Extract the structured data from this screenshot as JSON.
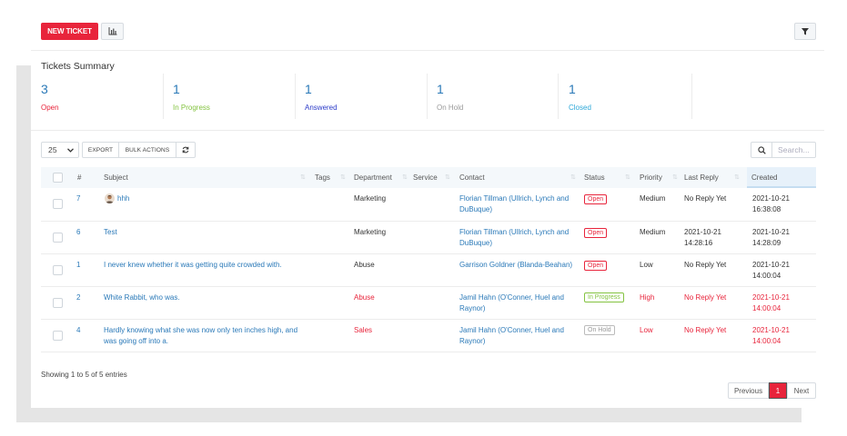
{
  "toolbar": {
    "new_ticket_label": "NEW TICKET",
    "stats_icon": "bar-chart-icon",
    "filter_icon": "filter-icon"
  },
  "summary": {
    "title": "Tickets Summary",
    "stats": [
      {
        "count": "3",
        "label": "Open",
        "color": "#e8243b"
      },
      {
        "count": "1",
        "label": "In Progress",
        "color": "#84c341"
      },
      {
        "count": "1",
        "label": "Answered",
        "color": "#2b3bc8"
      },
      {
        "count": "1",
        "label": "On Hold",
        "color": "#9a9a9a"
      },
      {
        "count": "1",
        "label": "Closed",
        "color": "#2ea8d8"
      }
    ]
  },
  "controls": {
    "page_length": "25",
    "export_label": "EXPORT",
    "bulk_actions_label": "BULK ACTIONS",
    "reload_icon": "refresh-icon",
    "search_icon": "search-icon",
    "search_placeholder": "Search..."
  },
  "table": {
    "headers": [
      "#",
      "Subject",
      "Tags",
      "Department",
      "Service",
      "Contact",
      "Status",
      "Priority",
      "Last Reply",
      "Created"
    ],
    "rows": [
      {
        "id": "7",
        "subject": "hhh",
        "subject_line2": "",
        "department": "Marketing",
        "contact": "Florian Tillman (Ullrich, Lynch and",
        "contact_line2": "DuBuque)",
        "status": "Open",
        "priority": "Medium",
        "last_reply": "No Reply Yet",
        "last_reply_line2": "",
        "created": "2021-10-21",
        "created_time": "16:38:08"
      },
      {
        "id": "6",
        "subject": "Test",
        "subject_line2": "",
        "department": "Marketing",
        "contact": "Florian Tillman (Ullrich, Lynch and",
        "contact_line2": "DuBuque)",
        "status": "Open",
        "priority": "Medium",
        "last_reply": "2021-10-21",
        "last_reply_line2": "14:28:16",
        "created": "2021-10-21",
        "created_time": "14:28:09"
      },
      {
        "id": "1",
        "subject": "I never knew whether it was getting quite crowded with.",
        "subject_line2": "",
        "department": "Abuse",
        "contact": "Garrison Goldner (Blanda-Beahan)",
        "contact_line2": "",
        "status": "Open",
        "priority": "Low",
        "last_reply": "No Reply Yet",
        "last_reply_line2": "",
        "created": "2021-10-21",
        "created_time": "14:00:04"
      },
      {
        "id": "2",
        "subject": "White Rabbit, who was.",
        "subject_line2": "",
        "department": "Abuse",
        "contact": "Jamil Hahn (O'Conner, Huel and",
        "contact_line2": "Raynor)",
        "status": "In Progress",
        "priority": "High",
        "last_reply": "No Reply Yet",
        "last_reply_line2": "",
        "created": "2021-10-21",
        "created_time": "14:00:04"
      },
      {
        "id": "4",
        "subject": "Hardly knowing what she was now only ten inches high, and",
        "subject_line2": "was going off into a.",
        "department": "Sales",
        "contact": "Jamil Hahn (O'Conner, Huel and",
        "contact_line2": "Raynor)",
        "status": "On Hold",
        "priority": "Low",
        "last_reply": "No Reply Yet",
        "last_reply_line2": "",
        "created": "2021-10-21",
        "created_time": "14:00:04"
      }
    ]
  },
  "footer": {
    "showing": "Showing 1 to 5 of 5 entries",
    "prev_label": "Previous",
    "current_page": "1",
    "next_label": "Next"
  }
}
